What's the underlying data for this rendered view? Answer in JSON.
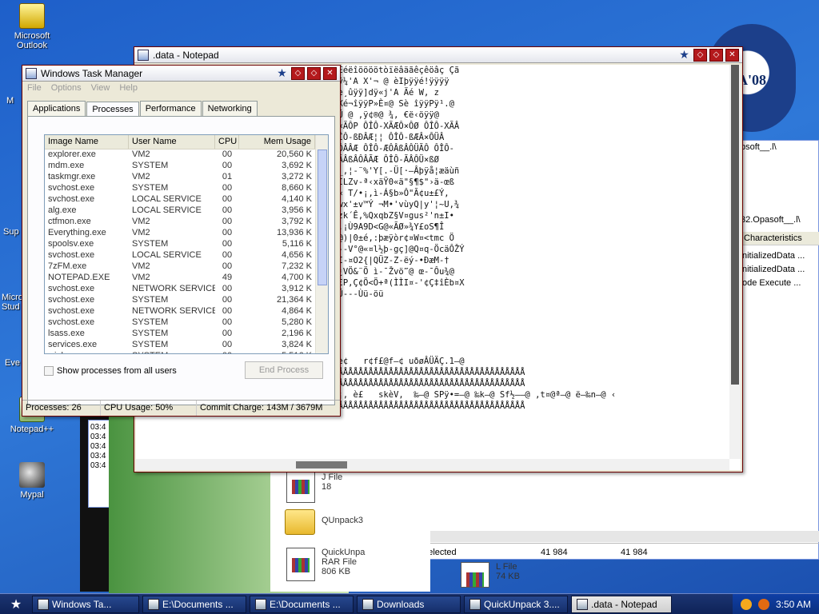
{
  "desktop": {
    "icons": [
      {
        "label": "Microsoft Outlook"
      },
      {
        "label": "Notepad++"
      },
      {
        "label": "Mypal"
      }
    ],
    "partial_labels": [
      "M",
      "Sup",
      "Micro Stud",
      "Eve"
    ],
    "poster_text": "MA'08"
  },
  "task_manager": {
    "title": "Windows Task Manager",
    "menu": [
      "File",
      "Options",
      "View",
      "Help"
    ],
    "tabs": [
      "Applications",
      "Processes",
      "Performance",
      "Networking"
    ],
    "active_tab": "Processes",
    "columns": [
      "Image Name",
      "User Name",
      "CPU",
      "Mem Usage"
    ],
    "rows": [
      [
        "explorer.exe",
        "VM2",
        "00",
        "20,560 K"
      ],
      [
        "mdm.exe",
        "SYSTEM",
        "00",
        "3,692 K"
      ],
      [
        "taskmgr.exe",
        "VM2",
        "01",
        "3,272 K"
      ],
      [
        "svchost.exe",
        "SYSTEM",
        "00",
        "8,660 K"
      ],
      [
        "svchost.exe",
        "LOCAL SERVICE",
        "00",
        "4,140 K"
      ],
      [
        "alg.exe",
        "LOCAL SERVICE",
        "00",
        "3,956 K"
      ],
      [
        "ctfmon.exe",
        "VM2",
        "00",
        "3,792 K"
      ],
      [
        "Everything.exe",
        "VM2",
        "00",
        "13,936 K"
      ],
      [
        "spoolsv.exe",
        "SYSTEM",
        "00",
        "5,116 K"
      ],
      [
        "svchost.exe",
        "LOCAL SERVICE",
        "00",
        "4,656 K"
      ],
      [
        "7zFM.exe",
        "VM2",
        "00",
        "7,232 K"
      ],
      [
        "NOTEPAD.EXE",
        "VM2",
        "49",
        "4,700 K"
      ],
      [
        "svchost.exe",
        "NETWORK SERVICE",
        "00",
        "3,912 K"
      ],
      [
        "svchost.exe",
        "SYSTEM",
        "00",
        "21,364 K"
      ],
      [
        "svchost.exe",
        "NETWORK SERVICE",
        "00",
        "4,864 K"
      ],
      [
        "svchost.exe",
        "SYSTEM",
        "00",
        "5,280 K"
      ],
      [
        "lsass.exe",
        "SYSTEM",
        "00",
        "2,196 K"
      ],
      [
        "services.exe",
        "SYSTEM",
        "00",
        "3,824 K"
      ],
      [
        "winlogon.exe",
        "SYSTEM",
        "00",
        "5,516 K"
      ]
    ],
    "show_all_label": "Show processes from all users",
    "end_process_label": "End Process",
    "status": {
      "processes": "Processes: 26",
      "cpu": "CPU Usage: 50%",
      "commit": "Commit Charge: 143M / 3679M"
    }
  },
  "notepad": {
    "title": ".data - Notepad",
    "lines": [
      "ö ÄäöÄôôôôäëòôôêäâööö ÉôäëÔôéäåôôöêïãé Ééëîöööötòïëâäãêçêöâç Çã",
      "ööÿÿé9!t«ô¬ @ ‹Äèêöÿÿ‹Éxé‹XPh/, h¬ @ j ÿ¼'A X'¬ @ èIþÿÿé!ÿÿÿÿ",
      "@ PSQ‹ÈSÌ¨ÇA<.uöIÆ, Y[Xè·öÿÿS‹öè öÿÿ[^Zè¸ûÿÿ]dÿ«j'A Äé W, z",
      "¸¢@ £g£@ XëÈîÿÿP» ¤@ Sê¼îÿÿPÿ¹.¢@ £ £@ Xé¬îÿÿP»È¤@ Sè îÿÿPÿ¹.@",
      "ëÿÿ»üE@ éÊêÿÿ»¬ @ èÄèÿÿé-øµ@ t;¢ü«@ ,¢¦Ü @ ,ÿ¢®@ ¾, €ë‹öÿÿ@",
      "¢ÔÎÔ-ÔÎÔ-XÃÂÜ£€Ôø ÔÎÔ-XÃÂÆÔ×ÃÔÂ ÔÎÔ-XÃÂ×ÃÔP ÔÎÔ-XÃÆÔ×ÔØ ÔÎÔ-XÃÂ",
      "ÔÎÔ-ßÔÔÂÜÔÔ ÔÎÔ-ßÔÃÂÆÆ£ ÔÎÔ-ßÔÃÂÆÆÂÆÆ ÔÎÔ-ßÐÂÆ¦¦ ÔÎÔ-ßÆÂ×ÔÜÂ",
      "ÔÎÔ-ÆÐÂ×ÜÜßÔÜØ ÔÎÔ-ÆÔßÂÆ§¦§§¦È¦ ÔÎÔ-ÆÐÂÔÂÂÆ ÔÎÔ-ÆÔÂßÂÔÜÃÔ ÔÎÔ-",
      "ÔØÂ ¦¤©¥¦ ÔÎÔ-ÃÃÔÔÜÔÃ ÔÎÔ-ÃÃPÂßØ¥¤ ÔÎÔ-ÃÂßÂÔÂÃÆ ÔÎÔ-ÃÂÔÜ×ßØ",
      "________________________________________,¦-¨%'Y[.-Ü[·—Âþÿå¦æäùñ",
      "Ç•¢qã%ÔtaMI¶fÅÆ/æîV\"¤VÀ]\"«<€Äþ¨'KÔfV„Ò»ÌLZv-ª‹xäŸ0«ä\"§¶$\"›ä-œß",
      "Ú1rÀ„Ò0p¦ÜIüL ¥]Òþ®-ÔtÑöÆ‹ª‡.¿xE¨ÎCÜV,-« T/•¡,ì-Á§b»Ô\"Ã¢u±£Ý,",
      "þD¶æ--HD®†È;«Æn@„w|±n¤ÉÜFßY<²öä©§*xe2„æwx'±v™Ý ¬M•'vùyQ|y'¦~U,¾",
      "%]SYXY3\\T,Ý|Giy.¡BF,q'¶5gwf¦bª†yÍub{k-}zk´Ê,%QxqbZ§V¤gus²'n±I•",
      "-ÜQsa¢‹nÄ@Ä\\ööä,@¼³B6ŒF¤ñêéÄCyŒYLÄš+ûº .¡Ù9A9D<G@«ÃØ»¾Y£oS¶Î",
      "\"'ß'>ÒÄŠR @ 7Ð«tgrëhb¬v¦ä'‚}9¬X>$€H>è¢¥@)|0±é,:þæÿòr¢¤W¤<tmc Ö",
      ",•yxh'Ö¢ H(Ñ6¦ù%U'rÝ±£-  ëŽx•¥@öø|ªZ„Ó1--V°@«¤l½þ-gç]@Q¤q-ÖcäÔŽÝ",
      "\"¥Y#÷ª·ÚGVÒò-•ÖÌï!äÒ¤æÄ9Äžä—P@ÖÄ-ÈCR+Q¼Ì-¤O2{|QÜZ-Z-ëý-•ÐæM-†",
      "/±ë@äI-f C@K©T\\- ŽÈ£‡8Öþ'<Ë'¨Ö§ Izf¶Z° ¿VÖ&¨Ö ì-¯Žvö‴@ œ-¯Ôu¾@",
      "ÈÆÈ¾¥Vèž»•\\Ö<èfb+2°@èbÄ-'«½Y>G‡s\"ö«™4)Ö€P,Ç¢Ö<Ö+ª(ÌÌI¤-'¢Ç‡îÈb¤X",
      "€Ç--Ö&--Ç&--¦&--¦&--&------ŸÖÀ@ÖÙŸ¤ ,ÖÙÜ---Ùü-öü",
      "",
      "",
      "",
      "",
      "",
      "ëô  ÄAþ.@ÿÿÿ¤Ph  @ Â¹ ‹µ[—@ „öt¦‹•¤@ ‹öè¢   r¢f£@f—¢ uðøÂÜÄÇ.1—@",
      "ÅÅÅÅÅÅÅÅÅÅÅÅÅÅÅÅÅÅÅÅÅÅÅÅÅÅÅÅÅÅÅÅÅÅÅÅÅÅÅÅÅÅÅÅÅÅÅÅÅÅÅÅÅÅÅÅÅÅÅÅÅÅÅÅÅÅÅÅÅÅÅÅÅÅÅÅ",
      "ÅÅÅÅÅÅÅÅÅÅÅÅÅÅÅÅÅÅÅÅÅÅÅÅÅÅÅÅÅÅÅÅÅÅÅÅÅÅÅÅÅÅÅÅÅÅÅÅÅÅÅÅÅÅÅÅÅÅÅÅÅÅÅÅÅÅÅÅÅÅÅÅÅÅÅÅ",
      " obtain a new copy. Checksum Failure! è¡, è£   skèV,  ‰—@ SPÿ•=—@ ‰k—@ Sf½——@ ,t¤@ª—@ ë—‰n—@ ‹",
      "ÅÅÅÅÅÅÅÅÅÅÅÅÅÅÅÅÅÅÅÅÅÅÅÅÅÅÅÅÅÅÅÅÅÅÅÅÅÅÅÅÅÅÅÅÅÅÅÅÅÅÅÅÅÅÅÅÅÅÅÅÅÅÅÅÅÅÅÅÅÅÅÅÅÅÅÅ"
    ]
  },
  "explorer": {
    "path_fragment": "psoft__.l\\",
    "path_fragment2": "32.Opasoft__.l\\",
    "column_header": "Characteristics",
    "col_items": [
      "nitializedData ...",
      "nitializedData ...",
      "ode Execute ..."
    ],
    "status_selected": "1 / 3 object(s) selected",
    "status_size1": "41 984",
    "status_size2": "41 984",
    "files": [
      {
        "name": "J File",
        "meta": "18"
      },
      {
        "name": "QUnpack3",
        "meta": ""
      },
      {
        "name": "QuickUnpa",
        "meta": "RAR File"
      },
      {
        "name": "L File",
        "meta": "74 KB"
      }
    ],
    "file_meta_size": "806 KB"
  },
  "bg_log": [
    "03:4",
    "03:4",
    "03:4",
    "03:4",
    "03:4"
  ],
  "taskbar": {
    "items": [
      {
        "label": "Windows Ta...",
        "active": false
      },
      {
        "label": "E:\\Documents ...",
        "active": false
      },
      {
        "label": "E:\\Documents ...",
        "active": false
      },
      {
        "label": "Downloads",
        "active": false
      },
      {
        "label": "QuickUnpack 3....",
        "active": false
      },
      {
        "label": ".data - Notepad",
        "active": true
      }
    ],
    "clock": "3:50 AM"
  }
}
